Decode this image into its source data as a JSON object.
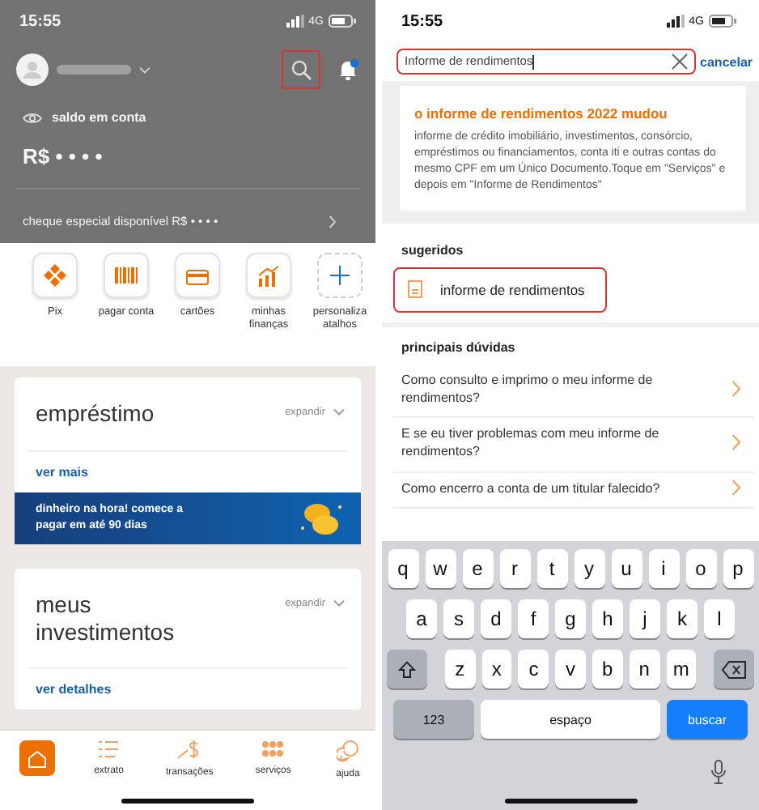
{
  "left_screen": {
    "status_bar": {
      "time": "15:55",
      "network": "4G"
    },
    "header": {
      "balance_label": "saldo em conta",
      "balance": "R$ • • • •",
      "overdraft": "cheque especial disponível R$ • • • •",
      "notification_dot": true
    },
    "shortcuts": [
      {
        "kind": "pix",
        "label": "Pix"
      },
      {
        "kind": "barcode",
        "label": "pagar conta"
      },
      {
        "kind": "card",
        "label": "cartões"
      },
      {
        "kind": "chart",
        "label": "minhas finanças"
      },
      {
        "kind": "add",
        "label": "personaliza atalhos"
      }
    ],
    "cards": [
      {
        "title": "empréstimo",
        "expand": "expandir",
        "link": "ver mais",
        "banner": "dinheiro na hora! comece a pagar em até 90 dias"
      },
      {
        "title": "meus investimentos",
        "expand": "expandir",
        "link": "ver detalhes"
      }
    ],
    "tab_bar": [
      {
        "kind": "home",
        "selected": true
      },
      {
        "kind": "list",
        "label": "extrato",
        "selected": false
      },
      {
        "kind": "money",
        "label": "transações",
        "selected": false
      },
      {
        "kind": "grid",
        "label": "serviços",
        "selected": false
      },
      {
        "kind": "chat",
        "label": "ajuda",
        "selected": false
      }
    ]
  },
  "right_screen": {
    "status_bar": {
      "time": "15:55",
      "network": "4G"
    },
    "search": {
      "value": "Informe de rendimentos",
      "cancel": "cancelar"
    },
    "notice": {
      "title": "o informe de rendimentos 2022 mudou",
      "body": "informe de crédito imobiliário, investimentos, consórcio, empréstimos ou financiamentos, conta iti e outras contas do mesmo CPF em um Único Documento.Toque em \"Serviços\" e depois em \"Informe de Rendimentos\""
    },
    "suggested": {
      "heading": "sugeridos",
      "items": [
        "informe de rendimentos"
      ]
    },
    "faq": {
      "heading": "principais dúvidas",
      "questions": [
        "Como consulto e imprimo o meu informe de rendimentos?",
        "E se eu tiver problemas com meu informe de rendimentos?",
        "Como encerro a conta de um titular falecido?"
      ]
    },
    "keyboard": {
      "rows": [
        [
          "q",
          "w",
          "e",
          "r",
          "t",
          "y",
          "u",
          "i",
          "o",
          "p"
        ],
        [
          "a",
          "s",
          "d",
          "f",
          "g",
          "h",
          "j",
          "k",
          "l"
        ],
        [
          "z",
          "x",
          "c",
          "v",
          "b",
          "n",
          "m"
        ]
      ],
      "numbers": "123",
      "space": "espaço",
      "action": "buscar"
    }
  }
}
